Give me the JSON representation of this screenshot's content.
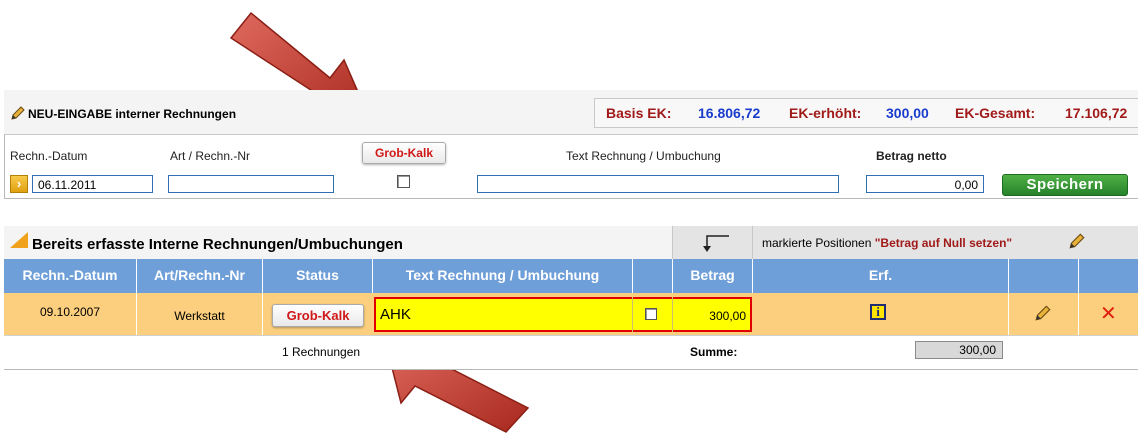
{
  "top": {
    "title": "NEU-EINGABE interner Rechnungen",
    "basis_label": "Basis EK:",
    "basis_value": "16.806,72",
    "erhoeht_label": "EK-erhöht:",
    "erhoeht_value": "300,00",
    "gesamt_label": "EK-Gesamt:",
    "gesamt_value": "17.106,72"
  },
  "form": {
    "datum_label": "Rechn.-Datum",
    "datum_value": "06.11.2011",
    "art_label": "Art / Rechn.-Nr",
    "art_value": "",
    "grob_label": "Grob-Kalk",
    "text_label": "Text Rechnung / Umbuchung",
    "text_value": "",
    "betrag_label": "Betrag netto",
    "betrag_value": "0,00",
    "save_label": "Speichern"
  },
  "list": {
    "title": "Bereits erfasste Interne Rechnungen/Umbuchungen",
    "marked_prefix": "markierte Positionen ",
    "marked_action": "\"Betrag auf Null setzen\"",
    "headers": {
      "datum": "Rechn.-Datum",
      "art": "Art/Rechn.-Nr",
      "status": "Status",
      "text": "Text Rechnung / Umbuchung",
      "betrag": "Betrag",
      "erf": "Erf."
    },
    "rows": [
      {
        "datum": "09.10.2007",
        "art": "Werkstatt",
        "status": "Grob-Kalk",
        "text": "AHK",
        "betrag": "300,00"
      }
    ],
    "count_text": "1 Rechnungen",
    "summe_label": "Summe:",
    "summe_value": "300,00"
  },
  "colors": {
    "header_blue": "#6f9fd8",
    "row_orange": "#fbcf7d",
    "highlight_yellow": "#ffff00",
    "arrow_red": "#c0392b",
    "save_green": "#2e8b32"
  }
}
